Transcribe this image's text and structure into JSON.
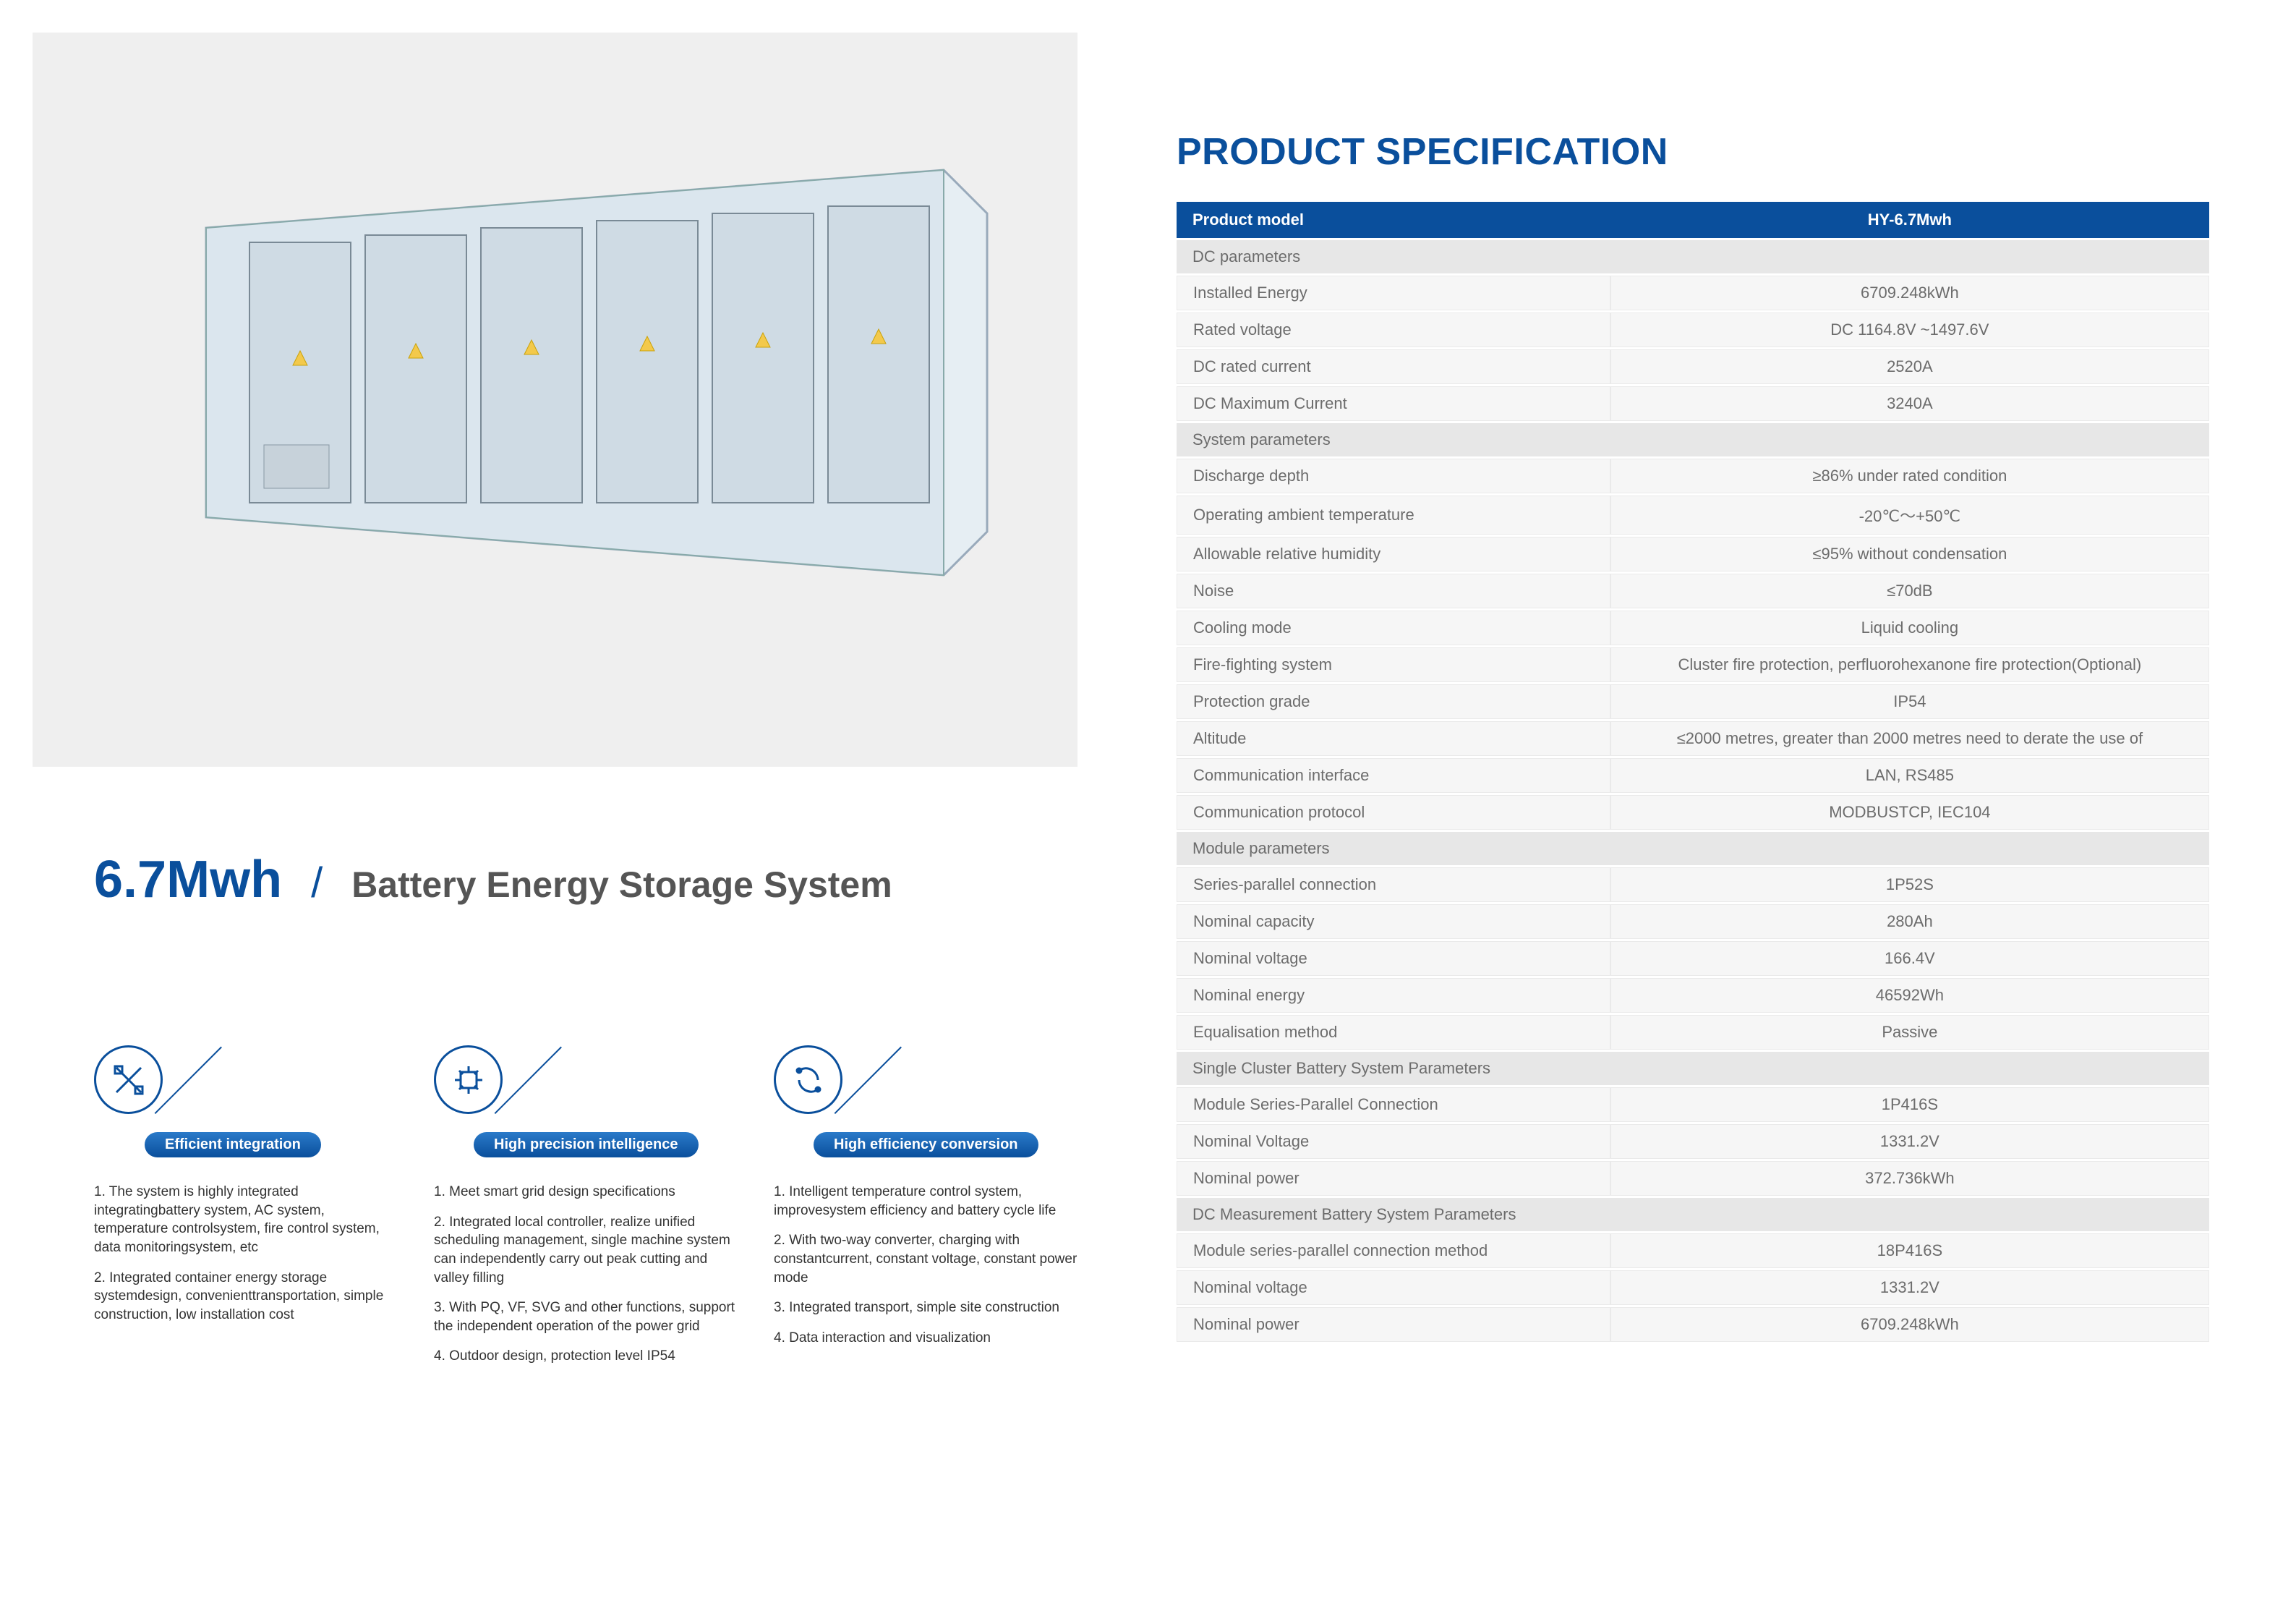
{
  "left": {
    "title_capacity": "6.7Mwh",
    "title_slash": "/",
    "title_name": "Battery Energy Storage System",
    "features": [
      {
        "icon": "design-icon",
        "pill": "Efficient integration",
        "paras": [
          "1. The system is highly integrated integratingbattery system, AC system, temperature controlsystem, fire control system, data monitoringsystem, etc",
          "2. Integrated container energy storage systemdesign, convenienttransportation, simple construction, low installation cost"
        ]
      },
      {
        "icon": "chip-icon",
        "pill": "High precision intelligence",
        "paras": [
          "1. Meet smart grid design specifications",
          "2. Integrated local controller, realize unified scheduling management, single machine system can independently carry out peak cutting and valley filling",
          "3. With PQ, VF, SVG and other functions, support the independent operation of the power grid",
          "4. Outdoor design, protection level IP54"
        ]
      },
      {
        "icon": "cycle-icon",
        "pill": "High efficiency conversion",
        "paras": [
          "1. Intelligent temperature control system, improvesystem efficiency and battery cycle life",
          "2. With two-way converter, charging with constantcurrent, constant voltage, constant power mode",
          "3. Integrated transport, simple site construction",
          "4. Data interaction and visualization"
        ]
      }
    ]
  },
  "spec": {
    "title": "PRODUCT SPECIFICATION",
    "header_label": "Product model",
    "header_value": "HY-6.7Mwh",
    "groups": [
      {
        "section": "DC parameters",
        "rows": [
          {
            "label": "Installed Energy",
            "value": "6709.248kWh"
          },
          {
            "label": "Rated voltage",
            "value": "DC 1164.8V ~1497.6V"
          },
          {
            "label": "DC rated current",
            "value": "2520A"
          },
          {
            "label": "DC Maximum Current",
            "value": "3240A"
          }
        ]
      },
      {
        "section": "System parameters",
        "rows": [
          {
            "label": "Discharge depth",
            "value": "≥86% under rated condition"
          },
          {
            "label": "Operating ambient temperature",
            "value": "-20℃～+50℃"
          },
          {
            "label": "Allowable relative humidity",
            "value": "≤95% without condensation"
          },
          {
            "label": "Noise",
            "value": "≤70dB"
          },
          {
            "label": "Cooling mode",
            "value": "Liquid cooling"
          },
          {
            "label": "Fire-fighting system",
            "value": "Cluster fire protection, perfluorohexanone fire protection(Optional)"
          },
          {
            "label": "Protection grade",
            "value": "IP54"
          },
          {
            "label": "Altitude",
            "value": "≤2000 metres, greater than 2000 metres need to derate the use of"
          },
          {
            "label": "Communication interface",
            "value": "LAN, RS485"
          },
          {
            "label": "Communication protocol",
            "value": "MODBUSTCP, IEC104"
          }
        ]
      },
      {
        "section": "Module parameters",
        "rows": [
          {
            "label": "Series-parallel connection",
            "value": "1P52S"
          },
          {
            "label": "Nominal capacity",
            "value": "280Ah"
          },
          {
            "label": "Nominal voltage",
            "value": "166.4V"
          },
          {
            "label": "Nominal energy",
            "value": "46592Wh"
          },
          {
            "label": "Equalisation method",
            "value": "Passive"
          }
        ]
      },
      {
        "section": "Single Cluster Battery System Parameters",
        "rows": [
          {
            "label": "Module Series-Parallel Connection",
            "value": "1P416S"
          },
          {
            "label": "Nominal Voltage",
            "value": "1331.2V"
          },
          {
            "label": "Nominal power",
            "value": "372.736kWh"
          }
        ]
      },
      {
        "section": "DC Measurement Battery System Parameters",
        "rows": [
          {
            "label": "Module series-parallel connection method",
            "value": "18P416S"
          },
          {
            "label": "Nominal voltage",
            "value": "1331.2V"
          },
          {
            "label": "Nominal power",
            "value": "6709.248kWh"
          }
        ]
      }
    ]
  }
}
